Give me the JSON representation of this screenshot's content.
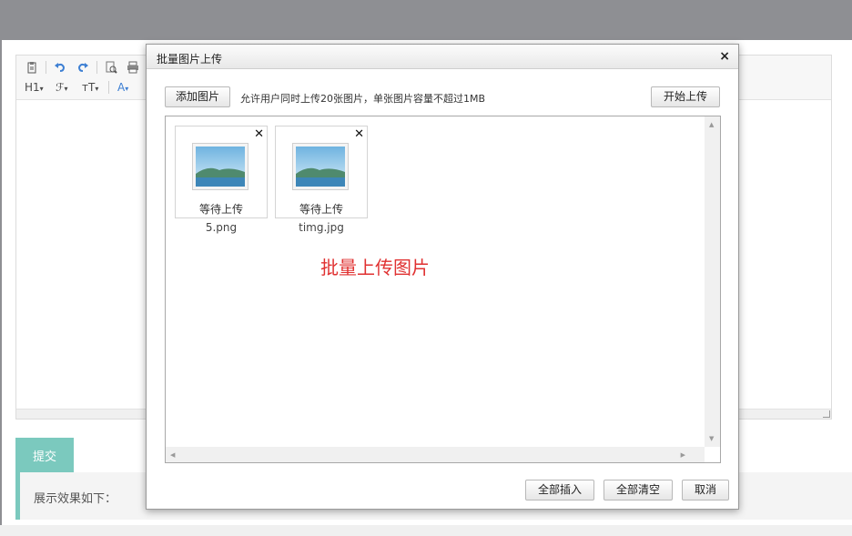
{
  "submit": {
    "label": "提交"
  },
  "preview": {
    "label": "展示效果如下："
  },
  "toolbar": {
    "heading_label": "H1",
    "font_label": "ℱ",
    "size_label": "ᴛT",
    "color_label": "A"
  },
  "dialog": {
    "title": "批量图片上传",
    "close_glyph": "×",
    "add_button": "添加图片",
    "hint": "允许用户同时上传20张图片，单张图片容量不超过1MB",
    "start_button": "开始上传",
    "files": [
      {
        "status": "等待上传",
        "name": "5.png"
      },
      {
        "status": "等待上传",
        "name": "timg.jpg"
      }
    ],
    "annotation": "批量上传图片",
    "insert_all_button": "全部插入",
    "clear_all_button": "全部清空",
    "cancel_button": "取消"
  },
  "icons": [
    "paste-icon",
    "undo-icon",
    "redo-icon",
    "preview-icon",
    "print-icon",
    "image-placeholder-icon",
    "close-icon"
  ],
  "colors": {
    "accent": "#7bc9be",
    "annotation": "#e03131",
    "topbar": "#8e8f93"
  }
}
